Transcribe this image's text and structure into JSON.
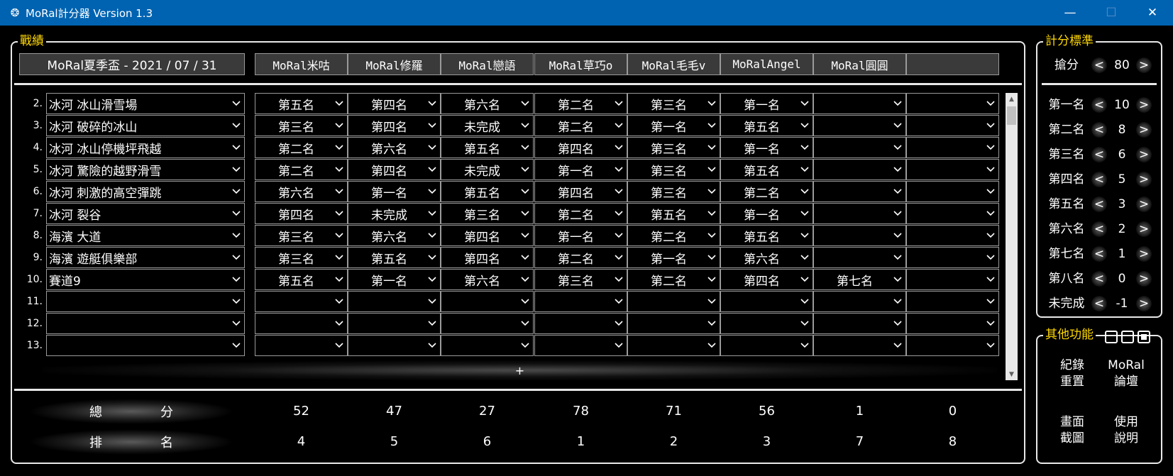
{
  "window": {
    "title": "MoRal計分器 Version 1.3",
    "minimize": "—",
    "maximize": "☐",
    "close": "✕"
  },
  "record": {
    "legend": "戰績",
    "event": "MoRal夏季盃 - 2021 / 07 / 31",
    "players": [
      "MoRal米咕",
      "MoRal修羅",
      "MoRal戀語",
      "MoRal草巧o",
      "MoRal毛毛v",
      "MoRalAngel",
      "MoRal圓圓",
      ""
    ],
    "rows": [
      {
        "num": "2.",
        "track": "冰河 冰山滑雪場",
        "places": [
          "第五名",
          "第四名",
          "第六名",
          "第二名",
          "第三名",
          "第一名",
          "",
          ""
        ]
      },
      {
        "num": "3.",
        "track": "冰河 破碎的冰山",
        "places": [
          "第三名",
          "第四名",
          "未完成",
          "第二名",
          "第一名",
          "第五名",
          "",
          ""
        ]
      },
      {
        "num": "4.",
        "track": "冰河 冰山停機坪飛越",
        "places": [
          "第二名",
          "第六名",
          "第五名",
          "第四名",
          "第三名",
          "第一名",
          "",
          ""
        ]
      },
      {
        "num": "5.",
        "track": "冰河 驚險的越野滑雪",
        "places": [
          "第二名",
          "第四名",
          "未完成",
          "第一名",
          "第三名",
          "第五名",
          "",
          ""
        ]
      },
      {
        "num": "6.",
        "track": "冰河 刺激的高空彈跳",
        "places": [
          "第六名",
          "第一名",
          "第五名",
          "第四名",
          "第三名",
          "第二名",
          "",
          ""
        ]
      },
      {
        "num": "7.",
        "track": "冰河 裂谷",
        "places": [
          "第四名",
          "未完成",
          "第三名",
          "第二名",
          "第五名",
          "第一名",
          "",
          ""
        ]
      },
      {
        "num": "8.",
        "track": "海濱 大道",
        "places": [
          "第三名",
          "第六名",
          "第四名",
          "第一名",
          "第二名",
          "第五名",
          "",
          ""
        ]
      },
      {
        "num": "9.",
        "track": "海濱 遊艇俱樂部",
        "places": [
          "第三名",
          "第五名",
          "第四名",
          "第二名",
          "第一名",
          "第六名",
          "",
          ""
        ]
      },
      {
        "num": "10.",
        "track": "賽道9",
        "places": [
          "第五名",
          "第一名",
          "第六名",
          "第三名",
          "第二名",
          "第四名",
          "第七名",
          ""
        ]
      },
      {
        "num": "11.",
        "track": "",
        "places": [
          "",
          "",
          "",
          "",
          "",
          "",
          "",
          ""
        ]
      },
      {
        "num": "12.",
        "track": "",
        "places": [
          "",
          "",
          "",
          "",
          "",
          "",
          "",
          ""
        ]
      },
      {
        "num": "13.",
        "track": "",
        "places": [
          "",
          "",
          "",
          "",
          "",
          "",
          "",
          ""
        ]
      }
    ],
    "add_label": "+",
    "total": {
      "label_a": "總",
      "label_b": "分",
      "values": [
        "52",
        "47",
        "27",
        "78",
        "71",
        "56",
        "1",
        "0"
      ]
    },
    "rank": {
      "label_a": "排",
      "label_b": "名",
      "values": [
        "4",
        "5",
        "6",
        "1",
        "2",
        "3",
        "7",
        "8"
      ]
    }
  },
  "scoring": {
    "legend": "計分標準",
    "rob": {
      "label": "搶分",
      "value": "80"
    },
    "items": [
      {
        "label": "第一名",
        "value": "10"
      },
      {
        "label": "第二名",
        "value": "8"
      },
      {
        "label": "第三名",
        "value": "6"
      },
      {
        "label": "第四名",
        "value": "5"
      },
      {
        "label": "第五名",
        "value": "3"
      },
      {
        "label": "第六名",
        "value": "2"
      },
      {
        "label": "第七名",
        "value": "1"
      },
      {
        "label": "第八名",
        "value": "0"
      },
      {
        "label": "未完成",
        "value": "-1"
      }
    ],
    "dec": "<",
    "inc": ">"
  },
  "other": {
    "legend": "其他功能",
    "buttons": [
      {
        "line1": "紀錄",
        "line2": "重置"
      },
      {
        "line1": "MoRal",
        "line2": "論壇"
      },
      {
        "line1": "畫面",
        "line2": "截圖"
      },
      {
        "line1": "使用",
        "line2": "說明"
      }
    ]
  }
}
